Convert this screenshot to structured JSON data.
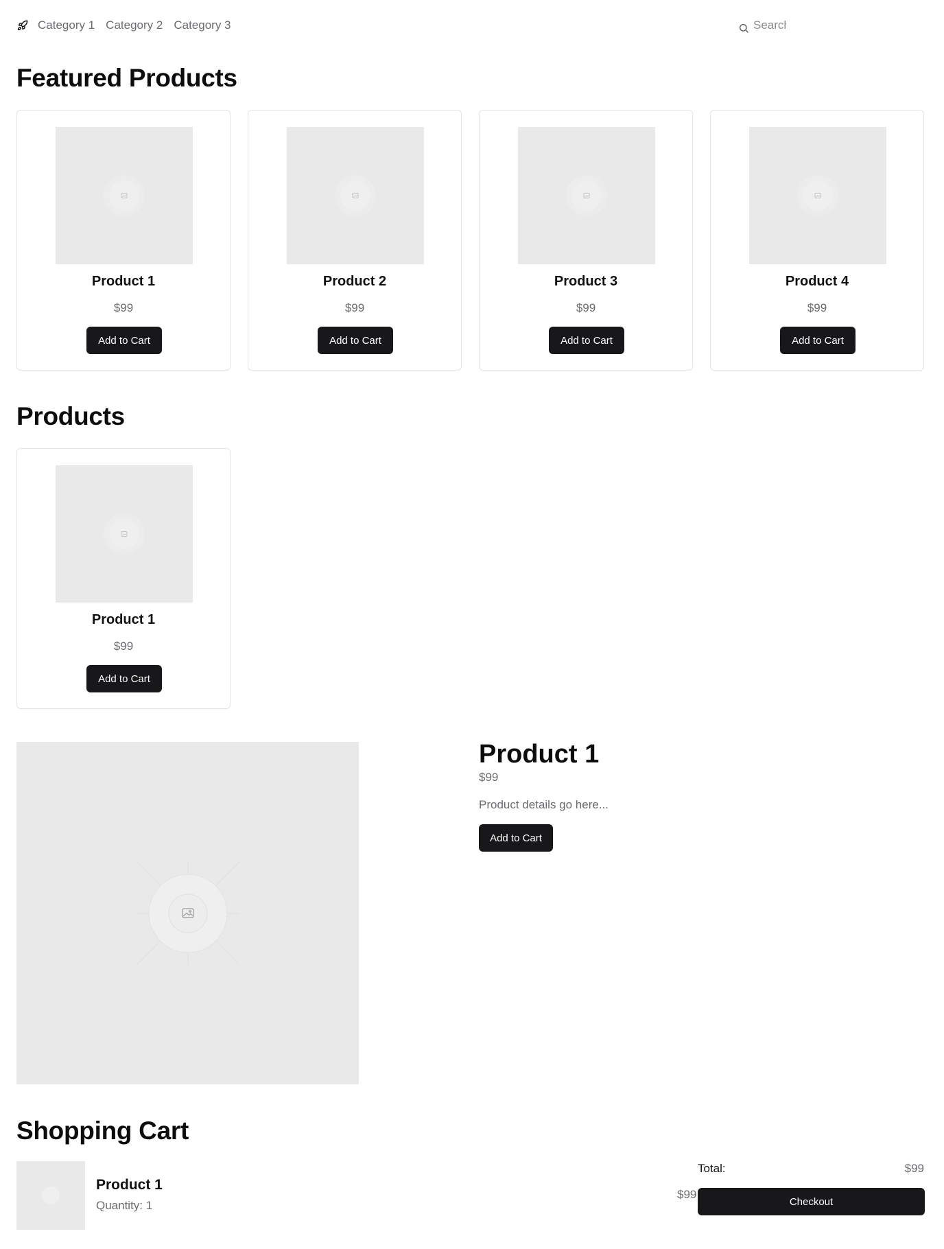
{
  "nav": {
    "logo_icon": "rocket-icon",
    "links": [
      "Category 1",
      "Category 2",
      "Category 3"
    ],
    "search_placeholder": "Search",
    "search_icon": "search-icon"
  },
  "featured": {
    "title": "Featured Products",
    "products": [
      {
        "name": "Product 1",
        "price": "$99",
        "button": "Add to Cart"
      },
      {
        "name": "Product 2",
        "price": "$99",
        "button": "Add to Cart"
      },
      {
        "name": "Product 3",
        "price": "$99",
        "button": "Add to Cart"
      },
      {
        "name": "Product 4",
        "price": "$99",
        "button": "Add to Cart"
      }
    ]
  },
  "products": {
    "title": "Products",
    "items": [
      {
        "name": "Product 1",
        "price": "$99",
        "button": "Add to Cart"
      }
    ]
  },
  "detail": {
    "title": "Product 1",
    "price": "$99",
    "description": "Product details go here...",
    "button": "Add to Cart",
    "image_icon": "image-placeholder-icon"
  },
  "cart": {
    "title": "Shopping Cart",
    "items": [
      {
        "name": "Product 1",
        "quantity": "Quantity: 1",
        "price": "$99"
      }
    ],
    "total_label": "Total:",
    "total_value": "$99",
    "checkout": "Checkout"
  },
  "colors": {
    "primary_button": "#18181b",
    "placeholder_bg": "#e9e9e9",
    "muted_text": "#6b6b70",
    "border": "#e4e4e7"
  }
}
